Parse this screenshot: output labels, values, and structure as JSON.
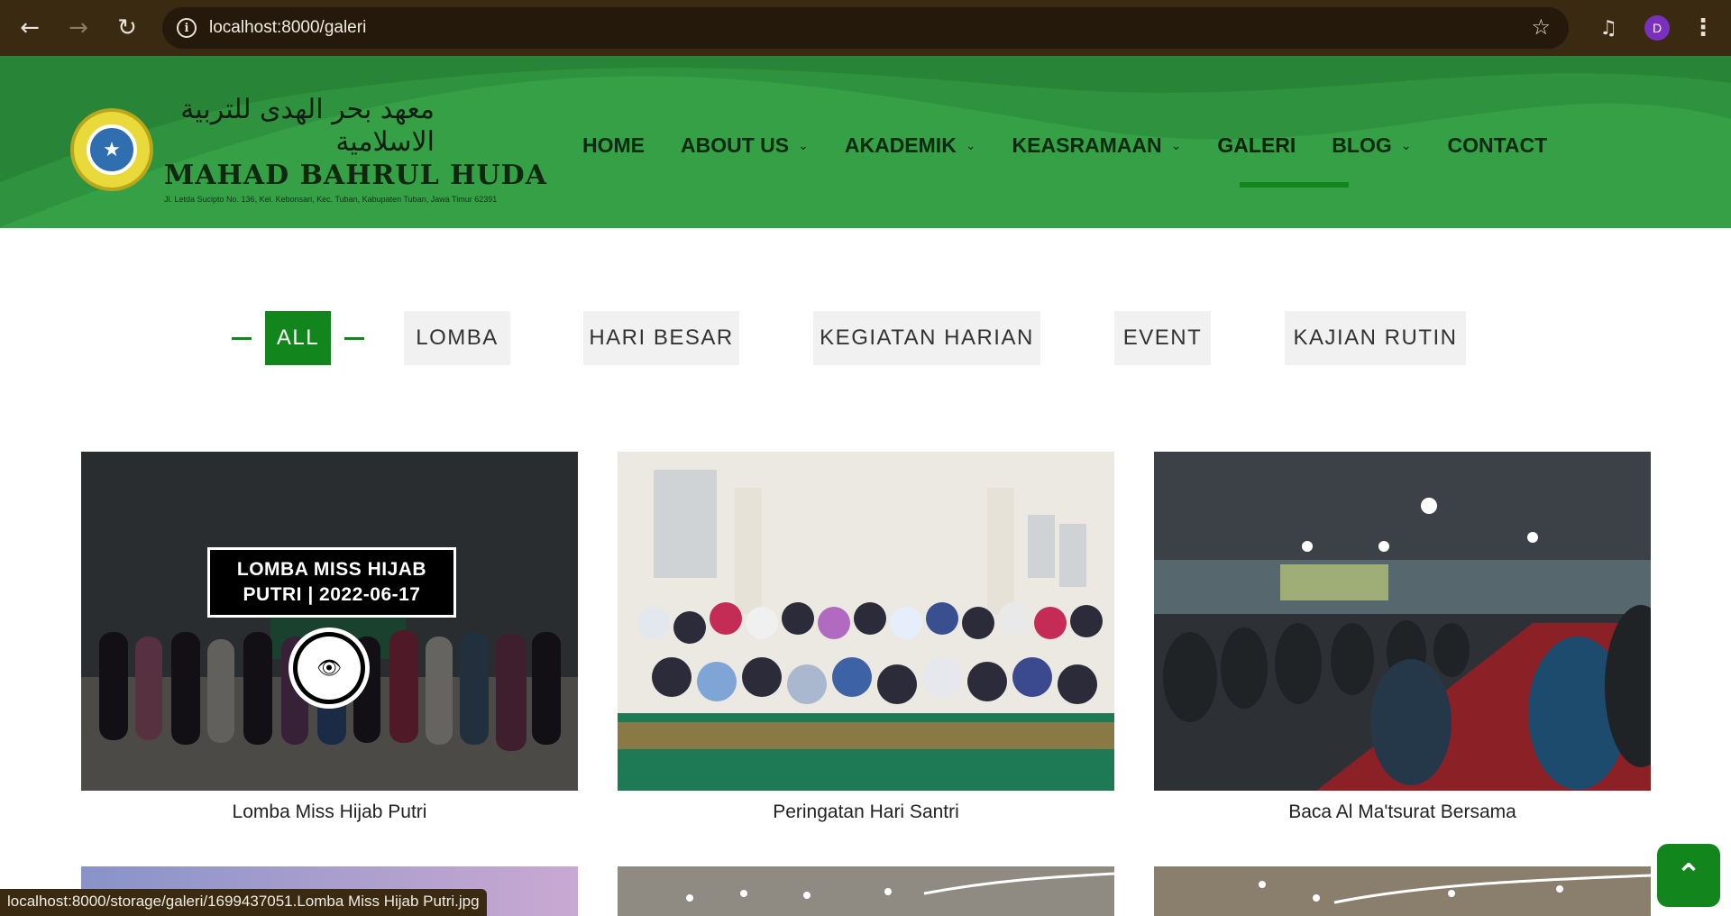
{
  "browser": {
    "url": "localhost:8000/galeri",
    "status_url": "localhost:8000/storage/galeri/1699437051.Lomba Miss Hijab Putri.jpg",
    "avatar_initial": "D"
  },
  "header": {
    "logo_arabic": "معهد بحر الهدى للتربية الاسلامية",
    "logo_title": "MAHAD BAHRUL HUDA",
    "logo_address": "Jl. Letda Sucipto No. 136, Kel. Kebonsari, Kec. Tuban, Kabupaten Tuban, Jawa Timur 62391"
  },
  "nav": {
    "items": [
      {
        "label": "HOME",
        "dropdown": false
      },
      {
        "label": "ABOUT US",
        "dropdown": true
      },
      {
        "label": "AKADEMIK",
        "dropdown": true
      },
      {
        "label": "KEASRAMAAN",
        "dropdown": true
      },
      {
        "label": "GALERI",
        "dropdown": false,
        "active": true
      },
      {
        "label": "BLOG",
        "dropdown": true
      },
      {
        "label": "CONTACT",
        "dropdown": false
      }
    ]
  },
  "filters": [
    {
      "label": "ALL",
      "active": true
    },
    {
      "label": "LOMBA"
    },
    {
      "label": "HARI BESAR"
    },
    {
      "label": "KEGIATAN HARIAN"
    },
    {
      "label": "EVENT"
    },
    {
      "label": "KAJIAN RUTIN"
    }
  ],
  "gallery": [
    {
      "caption": "Lomba Miss Hijab Putri",
      "overlay_title": "LOMBA MISS HIJAB PUTRI | 2022-06-17"
    },
    {
      "caption": "Peringatan Hari Santri"
    },
    {
      "caption": "Baca Al Ma'tsurat Bersama"
    }
  ],
  "colors": {
    "brand_green": "#35a046",
    "accent_green": "#12861d",
    "browser_bar": "#3a2a12"
  },
  "icons": {
    "back": "back-arrow-icon",
    "forward": "forward-arrow-icon",
    "reload": "reload-icon",
    "info": "info-icon",
    "star": "bookmark-star-icon",
    "media": "media-control-icon",
    "menu": "kebab-menu-icon",
    "eye": "eye-icon",
    "chevron_up": "chevron-up-icon"
  }
}
